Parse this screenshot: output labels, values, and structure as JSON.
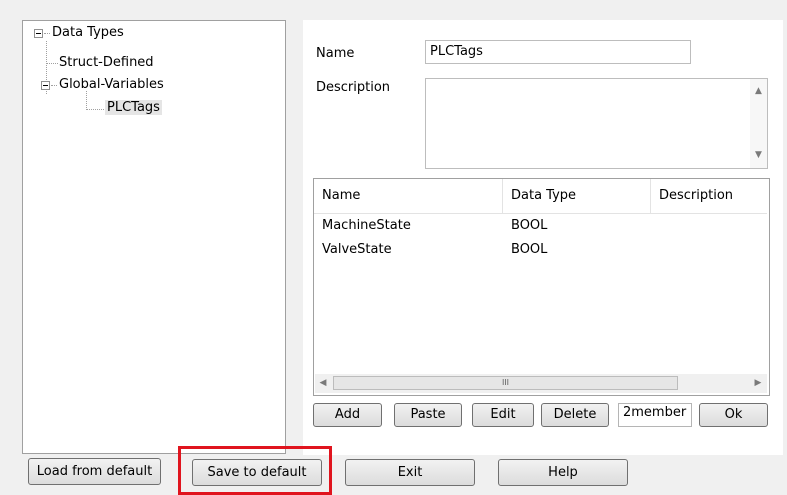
{
  "tree": {
    "root": {
      "label": "Data Types",
      "expanded": true
    },
    "children": [
      {
        "label": "Struct-Defined"
      },
      {
        "label": "Global-Variables",
        "expanded": true,
        "children": [
          {
            "label": "PLCTags",
            "selected": true
          }
        ]
      }
    ]
  },
  "form": {
    "name_label": "Name",
    "name_value": "PLCTags",
    "description_label": "Description",
    "description_value": ""
  },
  "table": {
    "columns": [
      "Name",
      "Data Type",
      "Description"
    ],
    "rows": [
      {
        "name": "MachineState",
        "data_type": "BOOL",
        "description": ""
      },
      {
        "name": "ValveState",
        "data_type": "BOOL",
        "description": ""
      }
    ]
  },
  "member_buttons": {
    "add": "Add",
    "paste": "Paste",
    "edit": "Edit",
    "delete": "Delete",
    "member_count": "2member",
    "ok": "Ok"
  },
  "bottom_buttons": {
    "load_default": "Load from default",
    "save_default": "Save to default",
    "exit": "Exit",
    "help": "Help"
  },
  "scroll_glyphs": {
    "up": "▲",
    "down": "▼",
    "left": "◀",
    "right": "▶",
    "grip": "III"
  },
  "colors": {
    "highlight": "#e0141e",
    "selection": "#e5e5e5"
  }
}
